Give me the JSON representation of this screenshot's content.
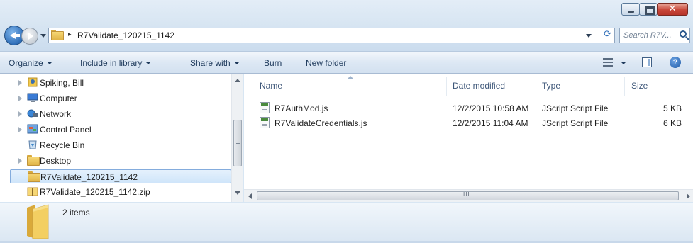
{
  "window": {
    "caption_buttons": {
      "minimize": "minimize",
      "maximize": "maximize",
      "close_symbol": "✕"
    }
  },
  "address_bar": {
    "path_separator": "▸",
    "path": "R7Validate_120215_1142",
    "refresh_symbol": "⟳"
  },
  "search": {
    "placeholder": "Search R7V..."
  },
  "toolbar": {
    "organize": "Organize",
    "include_in_library": "Include in library",
    "share_with": "Share with",
    "burn": "Burn",
    "new_folder": "New folder",
    "help_symbol": "?"
  },
  "nav_pane": {
    "items": [
      {
        "label": "Spiking, Bill",
        "icon": "user-folder-icon",
        "expandable": true
      },
      {
        "label": "Computer",
        "icon": "computer-icon",
        "expandable": true
      },
      {
        "label": "Network",
        "icon": "network-icon",
        "expandable": true
      },
      {
        "label": "Control Panel",
        "icon": "control-panel-icon",
        "expandable": true
      },
      {
        "label": "Recycle Bin",
        "icon": "recycle-bin-icon",
        "expandable": false
      },
      {
        "label": "Desktop",
        "icon": "folder-icon",
        "expandable": true
      },
      {
        "label": "R7Validate_120215_1142",
        "icon": "folder-icon",
        "expandable": false,
        "selected": true
      },
      {
        "label": "R7Validate_120215_1142.zip",
        "icon": "zip-folder-icon",
        "expandable": false
      }
    ]
  },
  "file_list": {
    "columns": {
      "name": "Name",
      "date_modified": "Date modified",
      "type": "Type",
      "size": "Size"
    },
    "rows": [
      {
        "name": "R7AuthMod.js",
        "date_modified": "12/2/2015 10:58 AM",
        "type": "JScript Script File",
        "size": "5 KB"
      },
      {
        "name": "R7ValidateCredentials.js",
        "date_modified": "12/2/2015 11:04 AM",
        "type": "JScript Script File",
        "size": "6 KB"
      }
    ],
    "hscroll_grip": "III"
  },
  "details_pane": {
    "item_count": "2 items"
  },
  "colors": {
    "frame": "#d8e6f3",
    "selection": "#cfe5fa",
    "folder": "#f6d775",
    "accent": "#2f6eb8"
  }
}
